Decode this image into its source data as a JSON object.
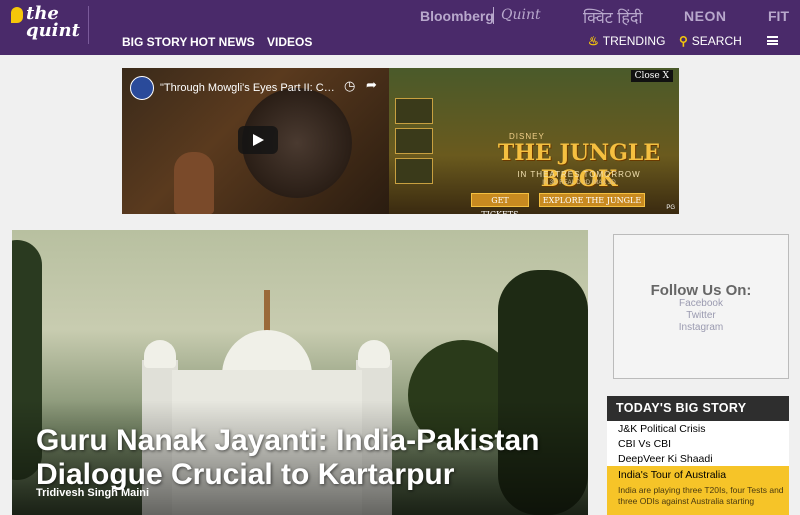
{
  "header": {
    "logo_text": "the quint",
    "brands": {
      "bloomberg": "Bloomberg",
      "quint": "Quint",
      "hindi": "क्विंट हिंदी",
      "neon": "NEON",
      "fit": "FIT"
    },
    "nav": {
      "big_story": "BIG STORY",
      "hot_news": "HOT NEWS",
      "videos": "VIDEOS",
      "trending": "TRENDING",
      "search": "SEARCH"
    },
    "colors": {
      "background": "#4a2a6a",
      "accent": "#f6c70a"
    }
  },
  "ad": {
    "video_title": "\"Through Mowgli's Eyes Part II: Co...",
    "close_label": "Close X",
    "tagline_small": "DISNEY",
    "headline": "THE JUNGLE BOOK",
    "sub": "IN THEATRES TOMORROW",
    "sub2": "IN 3D  REAL D 3D  IMAX 3D",
    "btn_tickets": "GET TICKETS",
    "btn_explore": "EXPLORE THE JUNGLE",
    "rating": "PG"
  },
  "hero": {
    "title": "Guru Nanak Jayanti: India-Pakistan Dialogue Crucial to Kartarpur",
    "author": "Tridivesh Singh Maini"
  },
  "follow": {
    "title": "Follow Us On:",
    "links": [
      "Facebook",
      "Twitter",
      "Instagram"
    ]
  },
  "big_story": {
    "header": "TODAY'S BIG STORY",
    "items": [
      "J&K Political Crisis",
      "CBI Vs CBI",
      "DeepVeer Ki Shaadi"
    ],
    "feature": {
      "title": "India's Tour of Australia",
      "description": "India are playing three T20Is, four Tests and three ODIs against Australia starting"
    },
    "colors": {
      "header_bg": "#2e2e2e",
      "feature_bg": "#f6c428"
    }
  }
}
